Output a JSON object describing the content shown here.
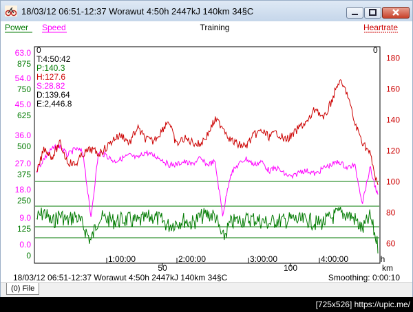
{
  "window": {
    "title": "18/03/12 06:51-12:37 Worawut 4:50h 2447kJ 140km 34§C",
    "icon": "cyclist-app-icon"
  },
  "chart": {
    "legend_power": "Power",
    "legend_speed": "Speed",
    "center_title": "Training",
    "legend_heartrate": "Heartrate",
    "colors": {
      "power": "#007a00",
      "speed": "#ff00ff",
      "heartrate": "#cc0000",
      "grid": "#007a00"
    },
    "info": [
      "0",
      "T:4:50:42",
      "P:140.3",
      "H:127.6",
      "S:28.82",
      "D:139.64",
      "E:2,446.8"
    ],
    "right_top_zero": "0",
    "speed_axis": [
      "63.0",
      "54.0",
      "45.0",
      "36.0",
      "27.0",
      "18.0",
      "9.0",
      "0.0"
    ],
    "power_axis": [
      "875",
      "750",
      "625",
      "500",
      "375",
      "250",
      "125",
      "0"
    ],
    "hr_axis": [
      "180",
      "160",
      "140",
      "120",
      "100",
      "80",
      "60"
    ],
    "time_ticks": [
      "1:00:00",
      "2:00:00",
      "3:00:00",
      "4:00:00"
    ],
    "time_unit": "h",
    "km_ticks": [
      "50",
      "100"
    ],
    "km_unit": "km"
  },
  "chart_data": {
    "type": "line",
    "title": "Training",
    "x_unit": "h",
    "x_secondary_unit": "km",
    "x_range": [
      "0:00:00",
      "4:50:42"
    ],
    "series": [
      {
        "name": "Heartrate",
        "axis": "right",
        "ylim": [
          50,
          190
        ],
        "values": [
          105,
          122,
          116,
          125,
          113,
          111,
          118,
          121,
          118,
          122,
          128,
          130,
          125,
          135,
          128,
          126,
          132,
          140,
          124,
          128,
          126,
          124,
          130,
          140,
          136,
          127,
          124,
          123,
          130,
          133,
          129,
          132,
          127,
          130,
          136,
          139,
          148,
          140,
          152,
          165,
          158,
          138,
          126,
          118,
          96
        ]
      },
      {
        "name": "Speed",
        "axis": "left",
        "ylim": [
          0,
          67.5
        ],
        "values": [
          28,
          32,
          35,
          36,
          33,
          35,
          34,
          13,
          34,
          33,
          31,
          32,
          33,
          32,
          34,
          33,
          32,
          30,
          30,
          31,
          30,
          32,
          30,
          31,
          14,
          27,
          30,
          32,
          30,
          31,
          28,
          29,
          27,
          26,
          28,
          28,
          27,
          29,
          30,
          31,
          29,
          30,
          18,
          29,
          20
        ]
      },
      {
        "name": "Power",
        "axis": "left",
        "ylim": [
          0,
          950
        ],
        "values": [
          180,
          210,
          160,
          200,
          170,
          195,
          150,
          80,
          185,
          180,
          170,
          175,
          175,
          165,
          180,
          190,
          175,
          150,
          165,
          175,
          160,
          185,
          200,
          195,
          90,
          160,
          175,
          175,
          180,
          170,
          160,
          175,
          170,
          180,
          170,
          175,
          160,
          165,
          185,
          205,
          200,
          180,
          130,
          190,
          60
        ]
      }
    ],
    "summary": {
      "T": "4:50:42",
      "P": "140.3",
      "H": "127.6",
      "S": "28.82",
      "D": "139.64",
      "E": "2,446.8"
    }
  },
  "status": {
    "left": "18/03/12 06:51-12:37 Worawut 4:50h 2447kJ 140km 34§C",
    "right": "Smoothing: 0:00:10"
  },
  "tabs": [
    "(0) File"
  ],
  "watermark": "[725x526] https://upic.me/"
}
